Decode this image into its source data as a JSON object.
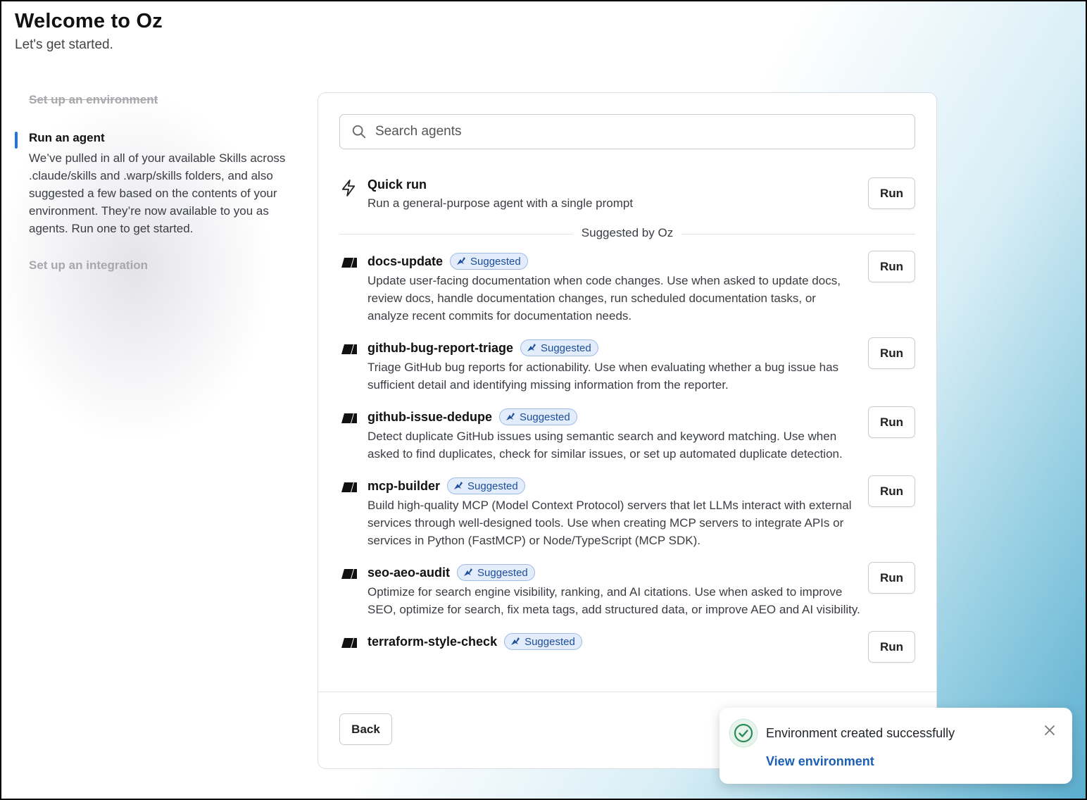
{
  "header": {
    "title": "Welcome to Oz",
    "subtitle": "Let's get started."
  },
  "steps": {
    "done_label": "Set up an environment",
    "active_title": "Run an agent",
    "active_description": "We’ve pulled in all of your available Skills across .claude/skills and .warp/skills folders, and also suggested a few based on the contents of your environment. They’re now available to you as agents. Run one to get started.",
    "todo_label": "Set up an integration"
  },
  "search": {
    "placeholder": "Search agents",
    "icon": "search-icon"
  },
  "quick_run": {
    "icon": "lightning-icon",
    "name": "Quick run",
    "description": "Run a general-purpose agent with a single prompt",
    "run_label": "Run"
  },
  "divider_label": "Suggested by Oz",
  "agents": [
    {
      "name": "docs-update",
      "badge": "Suggested",
      "description": "Update user-facing documentation when code changes. Use when asked to update docs, review docs, handle documentation changes, run scheduled documentation tasks, or analyze recent commits for documentation needs.",
      "run_label": "Run"
    },
    {
      "name": "github-bug-report-triage",
      "badge": "Suggested",
      "description": "Triage GitHub bug reports for actionability. Use when evaluating whether a bug issue has sufficient detail and identifying missing information from the reporter.",
      "run_label": "Run"
    },
    {
      "name": "github-issue-dedupe",
      "badge": "Suggested",
      "description": "Detect duplicate GitHub issues using semantic search and keyword matching. Use when asked to find duplicates, check for similar issues, or set up automated duplicate detection.",
      "run_label": "Run"
    },
    {
      "name": "mcp-builder",
      "badge": "Suggested",
      "description": "Build high-quality MCP (Model Context Protocol) servers that let LLMs interact with external services through well-designed tools. Use when creating MCP servers to integrate APIs or services in Python (FastMCP) or Node/TypeScript (MCP SDK).",
      "run_label": "Run"
    },
    {
      "name": "seo-aeo-audit",
      "badge": "Suggested",
      "description": "Optimize for search engine visibility, ranking, and AI citations. Use when asked to improve SEO, optimize for search, fix meta tags, add structured data, or improve AEO and AI visibility.",
      "run_label": "Run"
    },
    {
      "name": "terraform-style-check",
      "badge": "Suggested",
      "description": "",
      "run_label": "Run"
    }
  ],
  "footer": {
    "back_label": "Back"
  },
  "toast": {
    "icon": "check-circle-icon",
    "title": "Environment created successfully",
    "link": "View environment",
    "close_icon": "close-icon"
  },
  "colors": {
    "accent": "#1f74e0",
    "badge_bg": "#e2ecfa",
    "badge_text": "#1d4e9a",
    "success": "#2e8b57",
    "link": "#1a5fb4"
  }
}
